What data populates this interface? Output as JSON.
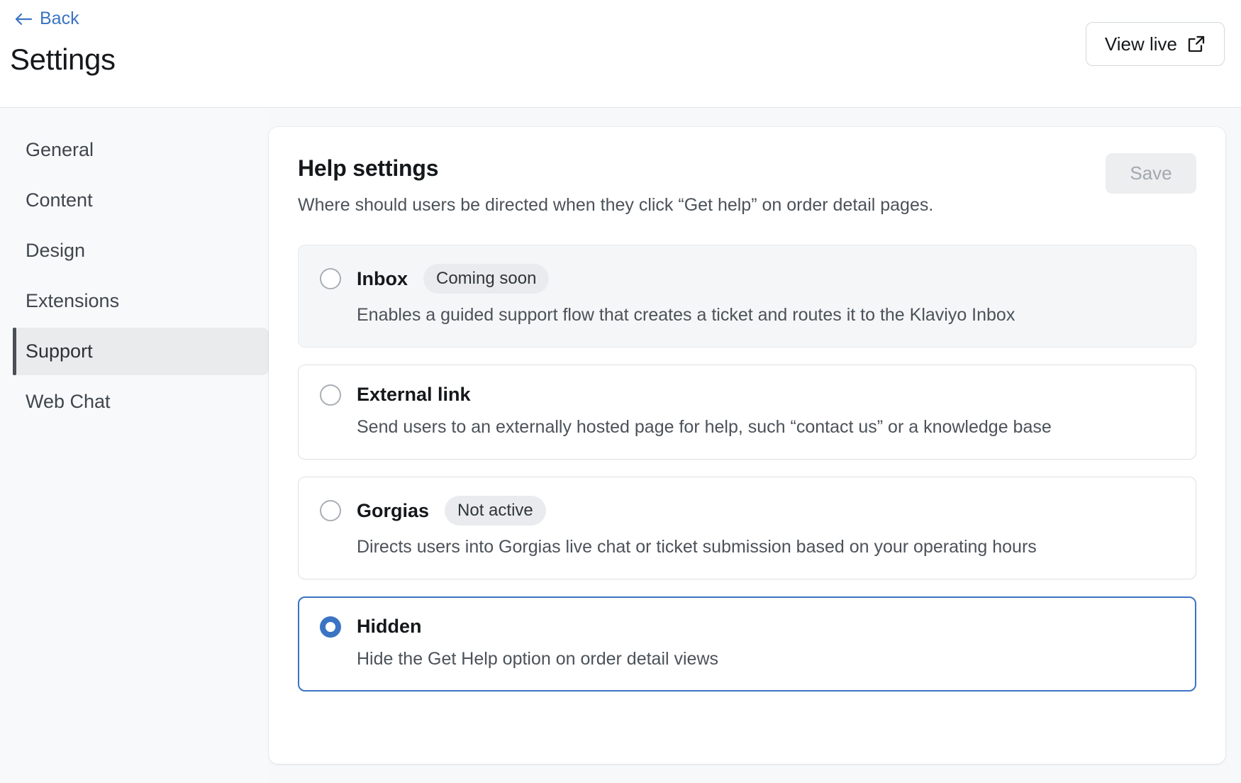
{
  "header": {
    "back_label": "Back",
    "back_icon": "arrow-left-icon",
    "title": "Settings",
    "view_live_label": "View live",
    "view_live_icon": "external-link-icon"
  },
  "sidebar": {
    "items": [
      {
        "label": "General",
        "active": false
      },
      {
        "label": "Content",
        "active": false
      },
      {
        "label": "Design",
        "active": false
      },
      {
        "label": "Extensions",
        "active": false
      },
      {
        "label": "Support",
        "active": true
      },
      {
        "label": "Web Chat",
        "active": false
      }
    ]
  },
  "main": {
    "title": "Help settings",
    "subtitle": "Where should users be directed when they click “Get help” on order detail pages.",
    "save_label": "Save",
    "save_disabled": true,
    "options": [
      {
        "id": "inbox",
        "title": "Inbox",
        "badge": "Coming soon",
        "description": "Enables a guided support flow that creates a ticket and routes it to the Klaviyo Inbox",
        "selected": false,
        "muted": true
      },
      {
        "id": "external-link",
        "title": "External link",
        "badge": "",
        "description": "Send users to an externally hosted page for help, such “contact us” or a knowledge base",
        "selected": false,
        "muted": false
      },
      {
        "id": "gorgias",
        "title": "Gorgias",
        "badge": "Not active",
        "description": "Directs users into Gorgias live chat or ticket submission based on your operating hours",
        "selected": false,
        "muted": false
      },
      {
        "id": "hidden",
        "title": "Hidden",
        "badge": "",
        "description": "Hide the Get Help option on order detail views",
        "selected": true,
        "muted": false
      }
    ]
  },
  "colors": {
    "accent_blue": "#3B74C4",
    "link_blue": "#3B74C4",
    "page_bg": "#F7F8FA",
    "card_bg": "#FFFFFF",
    "muted_bg": "#F5F6F8",
    "pill_bg": "#E9EBEE",
    "text_primary": "#15181B",
    "text_secondary": "#4B5259",
    "disabled_text": "#A2A8AE"
  }
}
